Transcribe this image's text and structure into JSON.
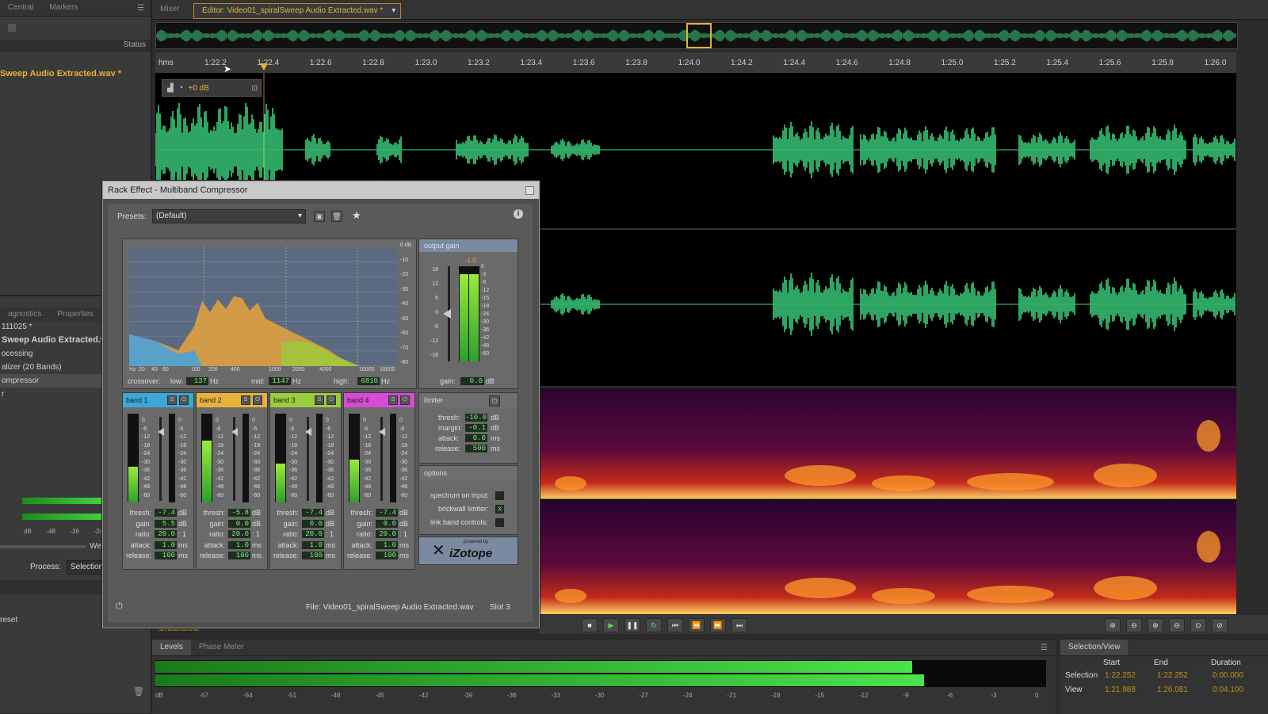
{
  "left_panel": {
    "tabs": [
      "Central",
      "Markers"
    ],
    "status_header": "Status",
    "file_name": "Sweep Audio Extracted.wav *",
    "diag_tabs": [
      "agnostics",
      "Properties"
    ],
    "effects_list": [
      "111025 *",
      "Sweep Audio Extracted.wa",
      "ocessing",
      "alizer (20 Bands)",
      "ompressor",
      "r"
    ],
    "meter_labels": [
      "dB",
      "-48",
      "-36",
      "-24"
    ],
    "we_label": "We",
    "process_label": "Process:",
    "process_value": "Selection",
    "reset_label": "reset"
  },
  "editor": {
    "mixer_tab": "Mixer",
    "editor_tab": "Editor: Video01_spiralSweep Audio Extracted.wav *",
    "ruler_unit": "hms",
    "ruler_ticks": [
      "1:22.2",
      "1:22.4",
      "1:22.6",
      "1:22.8",
      "1:23.0",
      "1:23.2",
      "1:23.4",
      "1:23.6",
      "1:23.8",
      "1:24.0",
      "1:24.2",
      "1:24.4",
      "1:24.6",
      "1:24.8",
      "1:25.0",
      "1:25.2",
      "1:25.4",
      "1:25.6",
      "1:25.8",
      "1:26.0"
    ],
    "hud_gain": "+0 dB"
  },
  "dialog": {
    "title": "Rack Effect - Multiband Compressor",
    "presets_label": "Presets:",
    "presets_value": "(Default)",
    "graph_db_labels": [
      "0 dB",
      "-10",
      "-20",
      "-30",
      "-40",
      "-50",
      "-60",
      "-70",
      "-80"
    ],
    "graph_hz_labels": [
      "Hz",
      "20",
      "40",
      "60",
      "100",
      "200",
      "400",
      "1000",
      "2000",
      "4000",
      "10000",
      "18000"
    ],
    "crossover_label": "crossover:",
    "low_label": "low:",
    "low_value": "137",
    "mid_label": "mid:",
    "mid_value": "1147",
    "high_label": "high:",
    "high_value": "6810",
    "hz": "Hz",
    "output_gain_label": "output gain",
    "output_gain_top": "-1.0",
    "output_scale_left": [
      "18",
      "12",
      "6",
      "0",
      "-6",
      "-12",
      "-18"
    ],
    "output_scale_right": [
      "0",
      "-3",
      "-6",
      "-12",
      "-15",
      "-18",
      "-24",
      "-30",
      "-36",
      "-42",
      "-48",
      "-60"
    ],
    "output_gain_label2": "gain:",
    "output_gain_value": "0.0",
    "db": "dB",
    "bands": [
      {
        "name": "band 1",
        "color": "#3aa8d8",
        "thresh": "-7.4",
        "gain": "5.5",
        "ratio": "20.0",
        "attack": "1.0",
        "release": "100"
      },
      {
        "name": "band 2",
        "color": "#e8b23a",
        "thresh": "-5.8",
        "gain": "0.0",
        "ratio": "20.0",
        "attack": "1.0",
        "release": "100"
      },
      {
        "name": "band 3",
        "color": "#9acd3c",
        "thresh": "-7.4",
        "gain": "0.0",
        "ratio": "20.0",
        "attack": "1.0",
        "release": "100"
      },
      {
        "name": "band 4",
        "color": "#d64ad6",
        "thresh": "-7.4",
        "gain": "0.0",
        "ratio": "20.0",
        "attack": "1.0",
        "release": "100"
      }
    ],
    "param_labels": {
      "thresh": "thresh:",
      "gain": "gain:",
      "ratio": "ratio:",
      "attack": "attack:",
      "release": "release:"
    },
    "units": {
      "db": "dB",
      "ratio": ": 1",
      "ms": "ms"
    },
    "band_scale": [
      "0",
      "-6",
      "-12",
      "-18",
      "-24",
      "-30",
      "-36",
      "-42",
      "-48",
      "-60"
    ],
    "limiter": {
      "label": "limiter",
      "thresh": "-10.0",
      "margin": "-0.1",
      "attack": "0.0",
      "release": "500"
    },
    "limiter_labels": {
      "thresh": "thresh:",
      "margin": "margin:",
      "attack": "attack:",
      "release": "release:"
    },
    "options": {
      "label": "options",
      "spectrum": "spectrum on input:",
      "brickwall": "brickwall limiter:",
      "link": "link band controls:",
      "brickwall_mark": "X"
    },
    "izotope_small": "powered by",
    "izotope": "iZotope",
    "file_label": "File: Video01_spiralSweep Audio Extracted.wav",
    "slot_label": "Slot 3"
  },
  "levels": {
    "tabs": [
      "Levels",
      "Phase Meter"
    ],
    "scale": [
      "dB",
      "-57",
      "-54",
      "-51",
      "-48",
      "-45",
      "-42",
      "-39",
      "-36",
      "-33",
      "-30",
      "-27",
      "-24",
      "-21",
      "-18",
      "-15",
      "-12",
      "-9",
      "-6",
      "-3",
      "0"
    ],
    "level_fraction": 0.85
  },
  "selection_view": {
    "tab": "Selection/View",
    "headers": [
      "Start",
      "End",
      "Duration"
    ],
    "rows": [
      {
        "label": "Selection",
        "start": "1:22.252",
        "end": "1:22.252",
        "duration": "0:00.000"
      },
      {
        "label": "View",
        "start": "1:21.988",
        "end": "1:26.081",
        "duration": "0:04.100"
      }
    ]
  },
  "time_display": "1:22.252",
  "colors": {
    "waveform": "#3ddc84",
    "accent": "#e4b23a",
    "meter_green": "#2ca02c"
  }
}
